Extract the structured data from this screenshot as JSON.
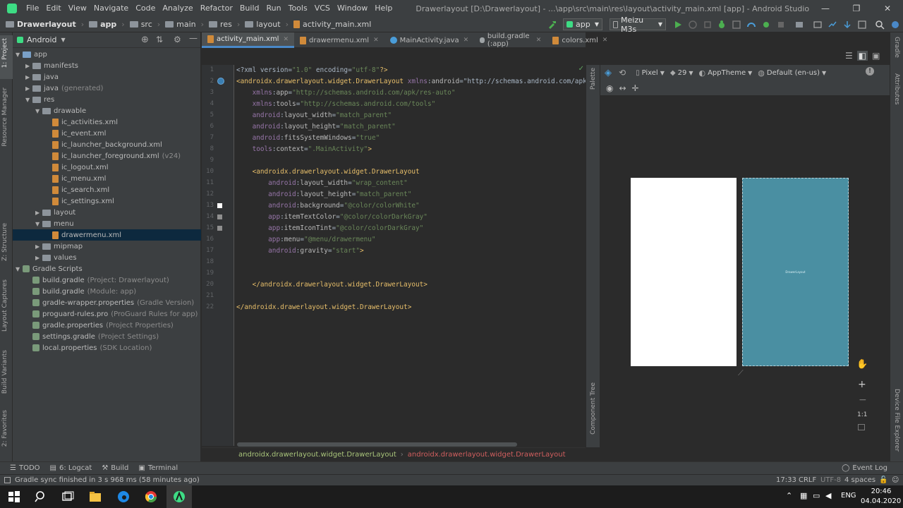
{
  "menu": {
    "items": [
      "File",
      "Edit",
      "View",
      "Navigate",
      "Code",
      "Analyze",
      "Refactor",
      "Build",
      "Run",
      "Tools",
      "VCS",
      "Window",
      "Help"
    ],
    "window_title": "Drawerlayout [D:\\Drawerlayout] - ...\\app\\src\\main\\res\\layout\\activity_main.xml [app] - Android Studio"
  },
  "nav": {
    "crumbs": [
      "Drawerlayout",
      "app",
      "src",
      "main",
      "res",
      "layout",
      "activity_main.xml"
    ],
    "run_config": "app",
    "device": "Meizu M3s"
  },
  "left_strip": {
    "project": "1: Project",
    "resource_manager": "Resource Manager",
    "structure": "Z: Structure",
    "layout_captures": "Layout Captures",
    "build_variants": "Build Variants",
    "favorites": "2: Favorites"
  },
  "project_panel": {
    "view_mode": "Android",
    "tree": [
      {
        "label": "app",
        "hint": "",
        "level": 0,
        "expanded": true,
        "kind": "module"
      },
      {
        "label": "manifests",
        "hint": "",
        "level": 1,
        "expanded": false,
        "kind": "folder"
      },
      {
        "label": "java",
        "hint": "",
        "level": 1,
        "expanded": false,
        "kind": "folder"
      },
      {
        "label": "java",
        "hint": "(generated)",
        "level": 1,
        "expanded": false,
        "kind": "folder"
      },
      {
        "label": "res",
        "hint": "",
        "level": 1,
        "expanded": true,
        "kind": "folder"
      },
      {
        "label": "drawable",
        "hint": "",
        "level": 2,
        "expanded": true,
        "kind": "folder"
      },
      {
        "label": "ic_activities.xml",
        "hint": "",
        "level": 3,
        "kind": "file"
      },
      {
        "label": "ic_event.xml",
        "hint": "",
        "level": 3,
        "kind": "file"
      },
      {
        "label": "ic_launcher_background.xml",
        "hint": "",
        "level": 3,
        "kind": "file"
      },
      {
        "label": "ic_launcher_foreground.xml",
        "hint": "(v24)",
        "level": 3,
        "kind": "file"
      },
      {
        "label": "ic_logout.xml",
        "hint": "",
        "level": 3,
        "kind": "file"
      },
      {
        "label": "ic_menu.xml",
        "hint": "",
        "level": 3,
        "kind": "file"
      },
      {
        "label": "ic_search.xml",
        "hint": "",
        "level": 3,
        "kind": "file"
      },
      {
        "label": "ic_settings.xml",
        "hint": "",
        "level": 3,
        "kind": "file"
      },
      {
        "label": "layout",
        "hint": "",
        "level": 2,
        "expanded": false,
        "kind": "folder"
      },
      {
        "label": "menu",
        "hint": "",
        "level": 2,
        "expanded": true,
        "kind": "folder"
      },
      {
        "label": "drawermenu.xml",
        "hint": "",
        "level": 3,
        "kind": "file",
        "selected": true
      },
      {
        "label": "mipmap",
        "hint": "",
        "level": 2,
        "expanded": false,
        "kind": "folder"
      },
      {
        "label": "values",
        "hint": "",
        "level": 2,
        "expanded": false,
        "kind": "folder"
      },
      {
        "label": "Gradle Scripts",
        "hint": "",
        "level": 0,
        "expanded": true,
        "kind": "gradle"
      },
      {
        "label": "build.gradle",
        "hint": "(Project: Drawerlayout)",
        "level": 1,
        "kind": "gradle-file"
      },
      {
        "label": "build.gradle",
        "hint": "(Module: app)",
        "level": 1,
        "kind": "gradle-file"
      },
      {
        "label": "gradle-wrapper.properties",
        "hint": "(Gradle Version)",
        "level": 1,
        "kind": "gradle-file"
      },
      {
        "label": "proguard-rules.pro",
        "hint": "(ProGuard Rules for app)",
        "level": 1,
        "kind": "gradle-file"
      },
      {
        "label": "gradle.properties",
        "hint": "(Project Properties)",
        "level": 1,
        "kind": "gradle-file"
      },
      {
        "label": "settings.gradle",
        "hint": "(Project Settings)",
        "level": 1,
        "kind": "gradle-file"
      },
      {
        "label": "local.properties",
        "hint": "(SDK Location)",
        "level": 1,
        "kind": "gradle-file"
      }
    ]
  },
  "tabs": [
    {
      "label": "activity_main.xml",
      "kind": "xml",
      "active": true
    },
    {
      "label": "drawermenu.xml",
      "kind": "xml",
      "active": false
    },
    {
      "label": "MainActivity.java",
      "kind": "java",
      "active": false
    },
    {
      "label": "build.gradle (:app)",
      "kind": "gradle",
      "active": false
    },
    {
      "label": "colors.xml",
      "kind": "xml",
      "active": false
    }
  ],
  "editor": {
    "lines": [
      {
        "n": "1",
        "text": "<?xml version=\"1.0\" encoding=\"utf-8\"?>"
      },
      {
        "n": "2",
        "text": "<androidx.drawerlayout.widget.DrawerLayout xmlns:android=\"http://schemas.android.com/apk/"
      },
      {
        "n": "3",
        "text": "    xmlns:app=\"http://schemas.android.com/apk/res-auto\""
      },
      {
        "n": "4",
        "text": "    xmlns:tools=\"http://schemas.android.com/tools\""
      },
      {
        "n": "5",
        "text": "    android:layout_width=\"match_parent\""
      },
      {
        "n": "6",
        "text": "    android:layout_height=\"match_parent\""
      },
      {
        "n": "7",
        "text": "    android:fitsSystemWindows=\"true\""
      },
      {
        "n": "8",
        "text": "    tools:context=\".MainActivity\">"
      },
      {
        "n": "9",
        "text": ""
      },
      {
        "n": "10",
        "text": "    <androidx.drawerlayout.widget.DrawerLayout"
      },
      {
        "n": "11",
        "text": "        android:layout_width=\"wrap_content\""
      },
      {
        "n": "12",
        "text": "        android:layout_height=\"match_parent\""
      },
      {
        "n": "13",
        "text": "        android:background=\"@color/colorWhite\""
      },
      {
        "n": "14",
        "text": "        app:itemTextColor=\"@color/colorDarkGray\""
      },
      {
        "n": "15",
        "text": "        app:itemIconTint=\"@color/colorDarkGray\""
      },
      {
        "n": "16",
        "text": "        app:menu=\"@menu/drawermenu\""
      },
      {
        "n": "17",
        "text": "        android:gravity=\"start\">"
      },
      {
        "n": "18",
        "text": ""
      },
      {
        "n": "19",
        "text": ""
      },
      {
        "n": "20",
        "text": "    </androidx.drawerlayout.widget.DrawerLayout>"
      },
      {
        "n": "21",
        "text": ""
      },
      {
        "n": "22",
        "text": "</androidx.drawerlayout.widget.DrawerLayout>"
      }
    ],
    "breadcrumb": [
      "androidx.drawerlayout.widget.DrawerLayout",
      "androidx.drawerlayout.widget.DrawerLayout"
    ]
  },
  "design": {
    "palette_label": "Palette",
    "component_tree_label": "Component Tree",
    "device": "Pixel",
    "api": "29",
    "theme": "AppTheme",
    "locale": "Default (en-us)",
    "preview_label": "DrawerLayout",
    "zoom_ratio": "1:1"
  },
  "right_strip": {
    "gradle": "Gradle",
    "attributes": "Attributes",
    "device_file_explorer": "Device File Explorer"
  },
  "toolwindows": {
    "todo": "TODO",
    "logcat": "6: Logcat",
    "build": "Build",
    "terminal": "Terminal",
    "event_log": "Event Log"
  },
  "status": {
    "message": "Gradle sync finished in 3 s 968 ms (58 minutes ago)",
    "position": "17:33",
    "line_sep": "CRLF",
    "encoding": "UTF-8",
    "indent": "4 spaces"
  },
  "taskbar": {
    "lang": "ENG",
    "time": "20:46",
    "date": "04.04.2020"
  },
  "colors": {
    "accent": "#4a88c7",
    "drawer_preview": "#4a8fa2",
    "selection": "#0d293e"
  }
}
